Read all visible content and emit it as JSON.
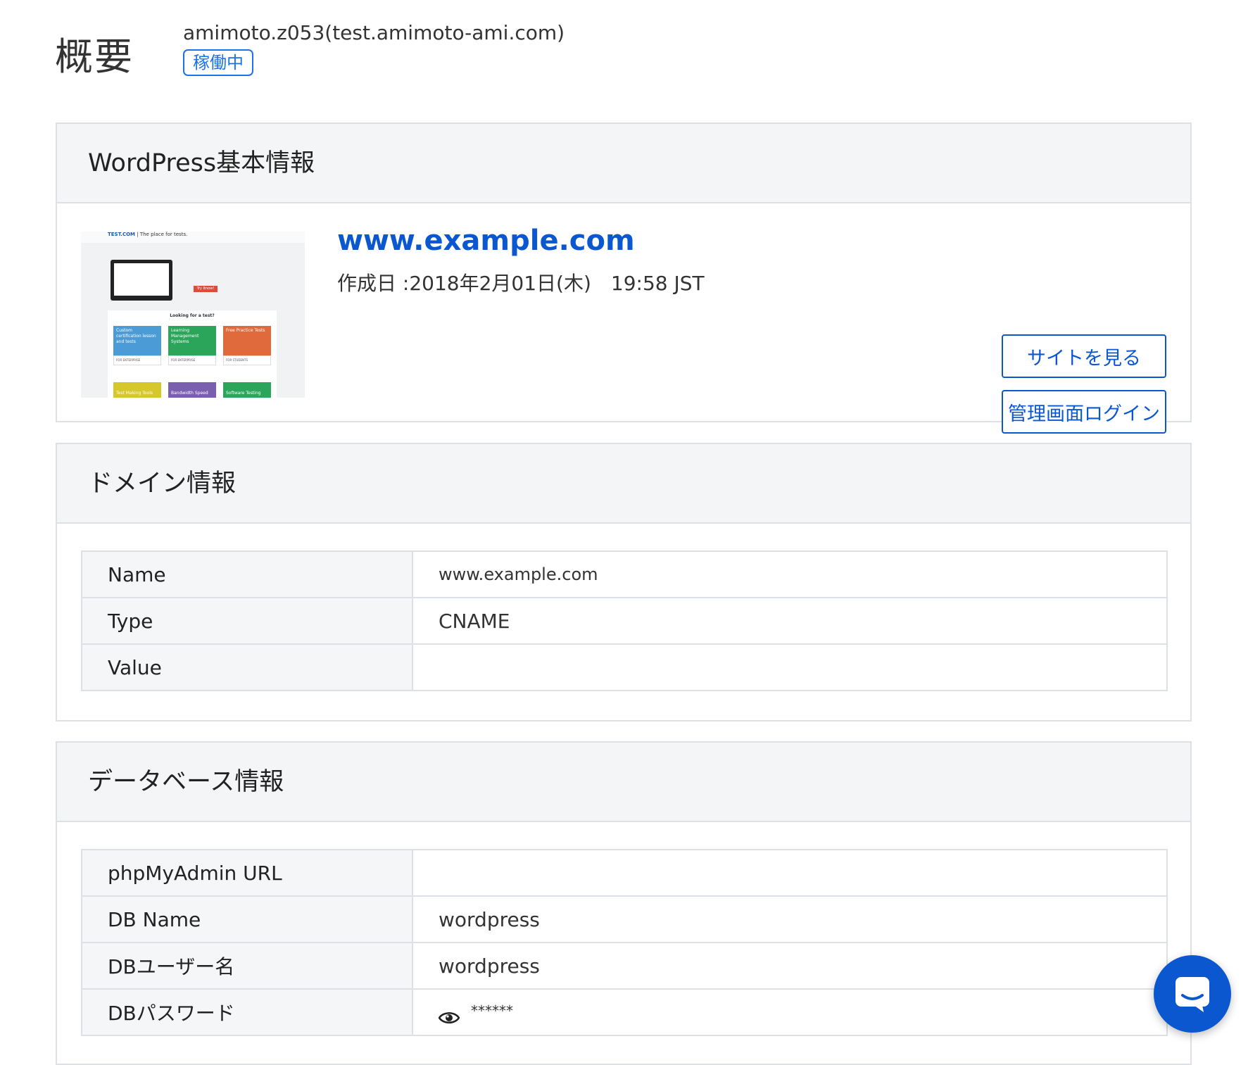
{
  "header": {
    "title": "概要",
    "server_name": "amimoto.z053(test.amimoto-ami.com)",
    "status": "稼働中"
  },
  "wordpress": {
    "section_title": "WordPress基本情報",
    "site_url": "www.example.com",
    "created": "作成日 :2018年2月01日(木)　19:58 JST",
    "view_site_button": "サイトを見る",
    "admin_login_button": "管理画面ログイン",
    "thumbnail": {
      "brand": "TEST.COM",
      "tagline": "The place for tests.",
      "try_button": "Try Itnow!",
      "looking": "Looking for a test?",
      "tiles": [
        {
          "label": "Custom certification lesson and tests",
          "link": "FOR ENTERPRISE",
          "color": "#4a9bd6"
        },
        {
          "label": "Learning Management Systems",
          "link": "FOR ENTERPRISE",
          "color": "#2aa55a"
        },
        {
          "label": "Free Practice Tests",
          "link": "FOR STUDENTS",
          "color": "#e06a3c"
        }
      ],
      "tiles_bottom": [
        {
          "label": "Test Making Tools",
          "color": "#d6c72a"
        },
        {
          "label": "Bandwidth Speed",
          "color": "#7a5fae"
        },
        {
          "label": "Software Testing",
          "color": "#2aa55a"
        }
      ]
    }
  },
  "domain": {
    "section_title": "ドメイン情報",
    "rows": [
      {
        "key": "Name",
        "value": "www.example.com"
      },
      {
        "key": "Type",
        "value": "CNAME"
      },
      {
        "key": "Value",
        "value": ""
      }
    ]
  },
  "database": {
    "section_title": "データベース情報",
    "rows": [
      {
        "key": "phpMyAdmin URL",
        "value": ""
      },
      {
        "key": "DB Name",
        "value": "wordpress"
      },
      {
        "key": "DBユーザー名",
        "value": "wordpress"
      },
      {
        "key": "DBパスワード",
        "value": "******"
      }
    ]
  },
  "colors": {
    "accent": "#0b57d0",
    "panel_header_bg": "#f3f5f7",
    "border": "#dde1e5"
  },
  "icons": {
    "password_toggle": "eye-icon",
    "chat": "chat-bubble-icon"
  }
}
